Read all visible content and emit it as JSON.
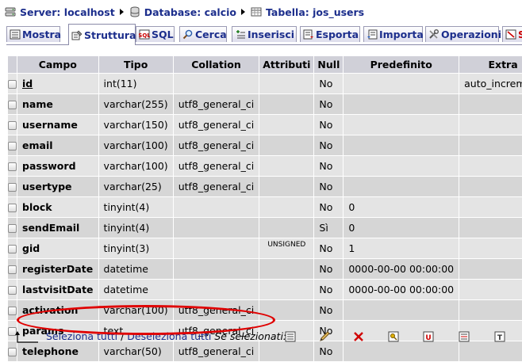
{
  "breadcrumb": {
    "server": "Server: localhost",
    "database": "Database: calcio",
    "table": "Tabella: jos_users"
  },
  "tabs": [
    {
      "label": "Mostra",
      "icon": "browse-icon",
      "active": false
    },
    {
      "label": "Struttura",
      "icon": "structure-icon",
      "active": true
    },
    {
      "label": "SQL",
      "icon": "sql-icon",
      "active": false
    },
    {
      "label": "Cerca",
      "icon": "search-icon",
      "active": false
    },
    {
      "label": "Inserisci",
      "icon": "insert-icon",
      "active": false
    },
    {
      "label": "Esporta",
      "icon": "export-icon",
      "active": false
    },
    {
      "label": "Importa",
      "icon": "import-icon",
      "active": false
    },
    {
      "label": "Operazioni",
      "icon": "operations-icon",
      "active": false
    },
    {
      "label": "S",
      "icon": "empty-icon",
      "active": false
    }
  ],
  "table": {
    "columns": [
      "Campo",
      "Tipo",
      "Collation",
      "Attributi",
      "Null",
      "Predefinito",
      "Extra"
    ],
    "rows": [
      {
        "field": "id",
        "type": "int(11)",
        "collation": "",
        "attributes": "",
        "null": "No",
        "default": "",
        "extra": "auto_increment",
        "primary": true
      },
      {
        "field": "name",
        "type": "varchar(255)",
        "collation": "utf8_general_ci",
        "attributes": "",
        "null": "No",
        "default": "",
        "extra": ""
      },
      {
        "field": "username",
        "type": "varchar(150)",
        "collation": "utf8_general_ci",
        "attributes": "",
        "null": "No",
        "default": "",
        "extra": ""
      },
      {
        "field": "email",
        "type": "varchar(100)",
        "collation": "utf8_general_ci",
        "attributes": "",
        "null": "No",
        "default": "",
        "extra": ""
      },
      {
        "field": "password",
        "type": "varchar(100)",
        "collation": "utf8_general_ci",
        "attributes": "",
        "null": "No",
        "default": "",
        "extra": ""
      },
      {
        "field": "usertype",
        "type": "varchar(25)",
        "collation": "utf8_general_ci",
        "attributes": "",
        "null": "No",
        "default": "",
        "extra": ""
      },
      {
        "field": "block",
        "type": "tinyint(4)",
        "collation": "",
        "attributes": "",
        "null": "No",
        "default": "0",
        "extra": ""
      },
      {
        "field": "sendEmail",
        "type": "tinyint(4)",
        "collation": "",
        "attributes": "",
        "null": "Sì",
        "default": "0",
        "extra": ""
      },
      {
        "field": "gid",
        "type": "tinyint(3)",
        "collation": "",
        "attributes": "UNSIGNED",
        "null": "No",
        "default": "1",
        "extra": ""
      },
      {
        "field": "registerDate",
        "type": "datetime",
        "collation": "",
        "attributes": "",
        "null": "No",
        "default": "0000-00-00 00:00:00",
        "extra": ""
      },
      {
        "field": "lastvisitDate",
        "type": "datetime",
        "collation": "",
        "attributes": "",
        "null": "No",
        "default": "0000-00-00 00:00:00",
        "extra": ""
      },
      {
        "field": "activation",
        "type": "varchar(100)",
        "collation": "utf8_general_ci",
        "attributes": "",
        "null": "No",
        "default": "",
        "extra": ""
      },
      {
        "field": "params",
        "type": "text",
        "collation": "utf8_general_ci",
        "attributes": "",
        "null": "No",
        "default": "",
        "extra": ""
      },
      {
        "field": "telephone",
        "type": "varchar(50)",
        "collation": "utf8_general_ci",
        "attributes": "",
        "null": "No",
        "default": "",
        "extra": ""
      }
    ]
  },
  "footer": {
    "select_all": "Seleziona tutti",
    "separator": " / ",
    "deselect_all": "Deseleziona tutti",
    "with_selected": "Se selezionati:",
    "actions": [
      "browse-icon",
      "edit-icon",
      "delete-icon",
      "primary-key-icon",
      "unique-icon",
      "index-icon",
      "fulltext-icon"
    ]
  },
  "colors": {
    "link": "#1c2e8c",
    "header_bg": "#d0d0d8",
    "row_odd": "#e4e4e4",
    "row_even": "#d6d6d6",
    "highlight_circle": "#e00000"
  }
}
